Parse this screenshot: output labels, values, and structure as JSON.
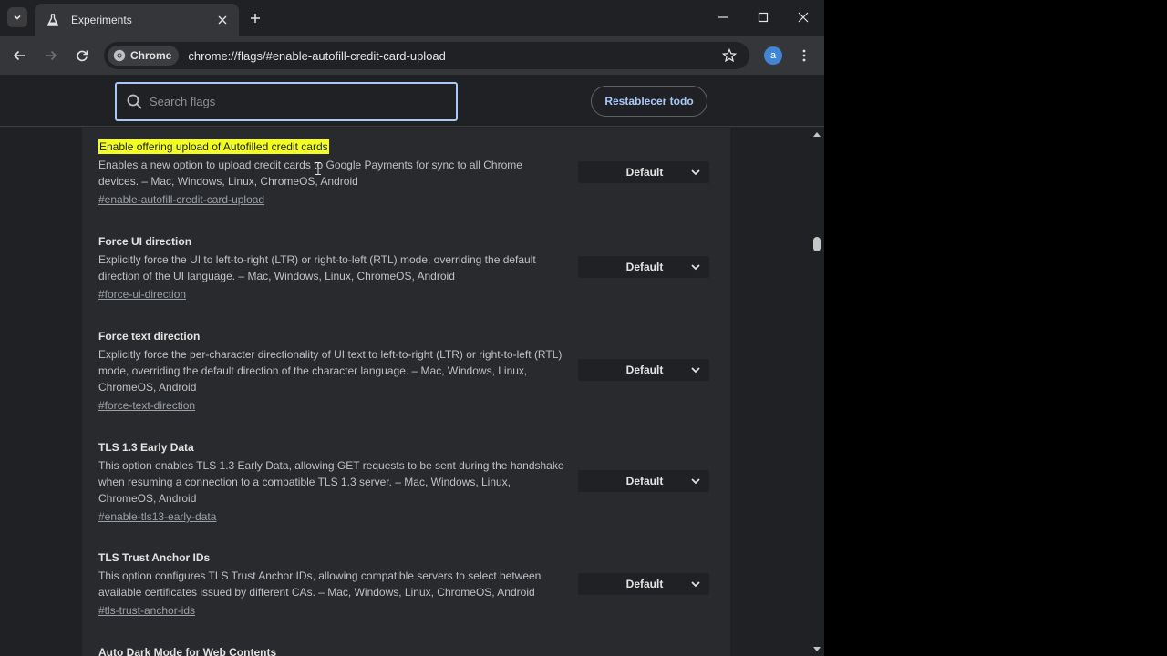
{
  "browser": {
    "tab": {
      "title": "Experiments"
    },
    "chip_label": "Chrome",
    "url": "chrome://flags/#enable-autofill-credit-card-upload",
    "avatar_letter": "a",
    "accent": "#a8c7fa"
  },
  "header": {
    "search_placeholder": "Search flags",
    "reset_label": "Restablecer todo"
  },
  "flags": [
    {
      "title": "Enable offering upload of Autofilled credit cards",
      "highlighted": true,
      "description": "Enables a new option to upload credit cards to Google Payments for sync to all Chrome devices. – Mac, Windows, Linux, ChromeOS, Android",
      "link": "#enable-autofill-credit-card-upload",
      "value": "Default"
    },
    {
      "title": "Force UI direction",
      "description": "Explicitly force the UI to left-to-right (LTR) or right-to-left (RTL) mode, overriding the default direction of the UI language. – Mac, Windows, Linux, ChromeOS, Android",
      "link": "#force-ui-direction",
      "value": "Default"
    },
    {
      "title": "Force text direction",
      "description": "Explicitly force the per-character directionality of UI text to left-to-right (LTR) or right-to-left (RTL) mode, overriding the default direction of the character language. – Mac, Windows, Linux, ChromeOS, Android",
      "link": "#force-text-direction",
      "value": "Default"
    },
    {
      "title": "TLS 1.3 Early Data",
      "description": "This option enables TLS 1.3 Early Data, allowing GET requests to be sent during the handshake when resuming a connection to a compatible TLS 1.3 server. – Mac, Windows, Linux, ChromeOS, Android",
      "link": "#enable-tls13-early-data",
      "value": "Default"
    },
    {
      "title": "TLS Trust Anchor IDs",
      "description": "This option configures TLS Trust Anchor IDs, allowing compatible servers to select between available certificates issued by different CAs. – Mac, Windows, Linux, ChromeOS, Android",
      "link": "#tls-trust-anchor-ids",
      "value": "Default"
    },
    {
      "title": "Auto Dark Mode for Web Contents"
    }
  ]
}
